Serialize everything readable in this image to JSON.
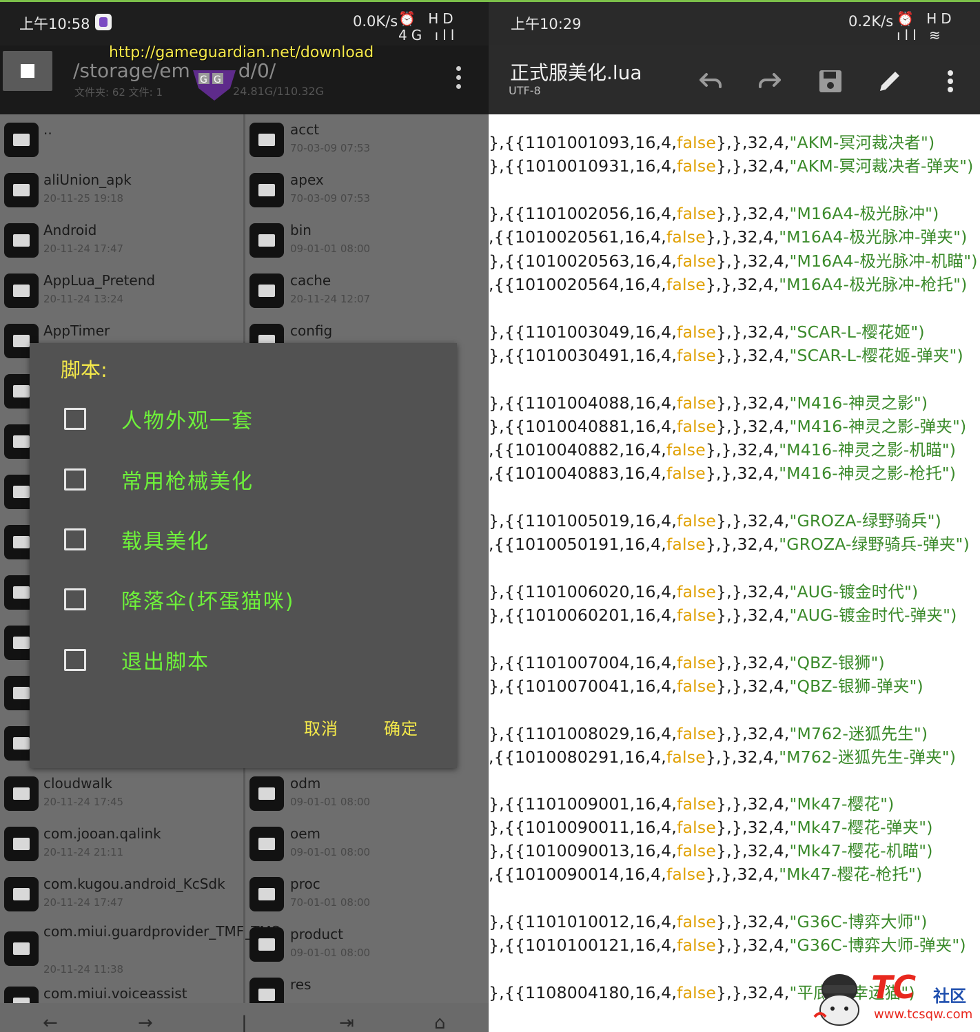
{
  "left": {
    "status": {
      "time": "上午10:58",
      "speed": "0.0K/s",
      "icons": "⏰ HD 4G ıll"
    },
    "toolbar": {
      "url": "http://gameguardian.net/download",
      "path": "/storage/em",
      "path_tail": "d/0/",
      "sub_info": "文件夹: 62  文件: 1",
      "size_info": "24.81G/110.32G"
    },
    "files_col1": [
      {
        "name": "..",
        "date": ""
      },
      {
        "name": "aliUnion_apk",
        "date": "20-11-25 19:18"
      },
      {
        "name": "Android",
        "date": "20-11-24 17:47"
      },
      {
        "name": "AppLua_Pretend",
        "date": "20-11-24 13:24"
      },
      {
        "name": "AppTimer",
        "date": ""
      },
      {
        "name": "cloudwalk",
        "date": "20-11-24 17:45"
      },
      {
        "name": "com.jooan.qalink",
        "date": "20-11-24 21:11"
      },
      {
        "name": "com.kugou.android_KcSdk",
        "date": "20-11-24 17:47"
      },
      {
        "name": "com.miui.guardprovider_TMF_TMS",
        "date": "20-11-24 11:38"
      },
      {
        "name": "com.miui.voiceassist",
        "date": ""
      }
    ],
    "files_col2": [
      {
        "name": "acct",
        "date": "70-03-09 07:53"
      },
      {
        "name": "apex",
        "date": "70-03-09 07:53"
      },
      {
        "name": "bin",
        "date": "09-01-01 08:00"
      },
      {
        "name": "cache",
        "date": "20-11-24 12:07"
      },
      {
        "name": "config",
        "date": ""
      },
      {
        "name": "odm",
        "date": "09-01-01 08:00"
      },
      {
        "name": "oem",
        "date": "09-01-01 08:00"
      },
      {
        "name": "proc",
        "date": "70-01-01 08:00"
      },
      {
        "name": "product",
        "date": "09-01-01 08:00"
      },
      {
        "name": "res",
        "date": ""
      }
    ],
    "dialog": {
      "title": "脚本:",
      "options": [
        "人物外观一套",
        "常用枪械美化",
        "载具美化",
        "降落伞(坏蛋猫咪)",
        "退出脚本"
      ],
      "cancel": "取消",
      "ok": "确定"
    },
    "nav": [
      "←",
      "→",
      "|",
      "⇥",
      "⌂"
    ]
  },
  "right": {
    "status": {
      "time": "上午10:29",
      "speed": "0.2K/s",
      "icons": "⏰ HD ıll ≋"
    },
    "appbar": {
      "filename": "正式服美化.lua",
      "encoding": "UTF-8"
    },
    "code_lines": [
      {
        "pre": "},{{1101001093,16,4,",
        "kw": "false",
        "post": "},},32,4,",
        "str": "\"AKM-冥河裁决者\")"
      },
      {
        "pre": "},{{1010010931,16,4,",
        "kw": "false",
        "post": "},},32,4,",
        "str": "\"AKM-冥河裁决者-弹夹\")"
      },
      {
        "pre": "},{{1101002056,16,4,",
        "kw": "false",
        "post": "},},32,4,",
        "str": "\"M16A4-极光脉冲\")"
      },
      {
        "pre": ",{{1010020561,16,4,",
        "kw": "false",
        "post": "},},32,4,",
        "str": "\"M16A4-极光脉冲-弹夹\")"
      },
      {
        "pre": "},{{1010020563,16,4,",
        "kw": "false",
        "post": "},},32,4,",
        "str": "\"M16A4-极光脉冲-机瞄\")"
      },
      {
        "pre": ",{{1010020564,16,4,",
        "kw": "false",
        "post": "},},32,4,",
        "str": "\"M16A4-极光脉冲-枪托\")"
      },
      {
        "pre": "},{{1101003049,16,4,",
        "kw": "false",
        "post": "},},32,4,",
        "str": "\"SCAR-L-樱花姬\")"
      },
      {
        "pre": "},{{1010030491,16,4,",
        "kw": "false",
        "post": "},},32,4,",
        "str": "\"SCAR-L-樱花姬-弹夹\")"
      },
      {
        "pre": "},{{1101004088,16,4,",
        "kw": "false",
        "post": "},},32,4,",
        "str": "\"M416-神灵之影\")"
      },
      {
        "pre": "},{{1010040881,16,4,",
        "kw": "false",
        "post": "},},32,4,",
        "str": "\"M416-神灵之影-弹夹\")"
      },
      {
        "pre": ",{{1010040882,16,4,",
        "kw": "false",
        "post": "},},32,4,",
        "str": "\"M416-神灵之影-机瞄\")"
      },
      {
        "pre": ",{{1010040883,16,4,",
        "kw": "false",
        "post": "},},32,4,",
        "str": "\"M416-神灵之影-枪托\")"
      },
      {
        "pre": "},{{1101005019,16,4,",
        "kw": "false",
        "post": "},},32,4,",
        "str": "\"GROZA-绿野骑兵\")"
      },
      {
        "pre": ",{{1010050191,16,4,",
        "kw": "false",
        "post": "},},32,4,",
        "str": "\"GROZA-绿野骑兵-弹夹\")"
      },
      {
        "pre": "},{{1101006020,16,4,",
        "kw": "false",
        "post": "},},32,4,",
        "str": "\"AUG-镀金时代\")"
      },
      {
        "pre": "},{{1010060201,16,4,",
        "kw": "false",
        "post": "},},32,4,",
        "str": "\"AUG-镀金时代-弹夹\")"
      },
      {
        "pre": "},{{1101007004,16,4,",
        "kw": "false",
        "post": "},},32,4,",
        "str": "\"QBZ-银狮\")"
      },
      {
        "pre": "},{{1010070041,16,4,",
        "kw": "false",
        "post": "},},32,4,",
        "str": "\"QBZ-银狮-弹夹\")"
      },
      {
        "pre": "},{{1101008029,16,4,",
        "kw": "false",
        "post": "},},32,4,",
        "str": "\"M762-迷狐先生\")"
      },
      {
        "pre": ",{{1010080291,16,4,",
        "kw": "false",
        "post": "},},32,4,",
        "str": "\"M762-迷狐先生-弹夹\")"
      },
      {
        "pre": "},{{1101009001,16,4,",
        "kw": "false",
        "post": "},},32,4,",
        "str": "\"Mk47-樱花\")"
      },
      {
        "pre": "},{{1010090011,16,4,",
        "kw": "false",
        "post": "},},32,4,",
        "str": "\"Mk47-樱花-弹夹\")"
      },
      {
        "pre": "},{{1010090013,16,4,",
        "kw": "false",
        "post": "},},32,4,",
        "str": "\"Mk47-樱花-机瞄\")"
      },
      {
        "pre": ",{{1010090014,16,4,",
        "kw": "false",
        "post": "},},32,4,",
        "str": "\"Mk47-樱花-枪托\")"
      },
      {
        "pre": "},{{1101010012,16,4,",
        "kw": "false",
        "post": "},},32,4,",
        "str": "\"G36C-博弈大师\")"
      },
      {
        "pre": "},{{1010100121,16,4,",
        "kw": "false",
        "post": "},},32,4,",
        "str": "\"G36C-博弈大师-弹夹\")"
      },
      {
        "pre": "},{{1108004180,16,4,",
        "kw": "false",
        "post": "},},32,4,",
        "str": "\"平底锅-幸运猫\")"
      }
    ]
  },
  "watermark": {
    "brand": "TC",
    "community": "社区",
    "site": "www.tcsqw.com"
  },
  "colors": {
    "accent_green": "#6ef23a",
    "accent_yellow": "#f4e94a",
    "code_keyword": "#e0a000",
    "code_string": "#3a8a2a"
  }
}
